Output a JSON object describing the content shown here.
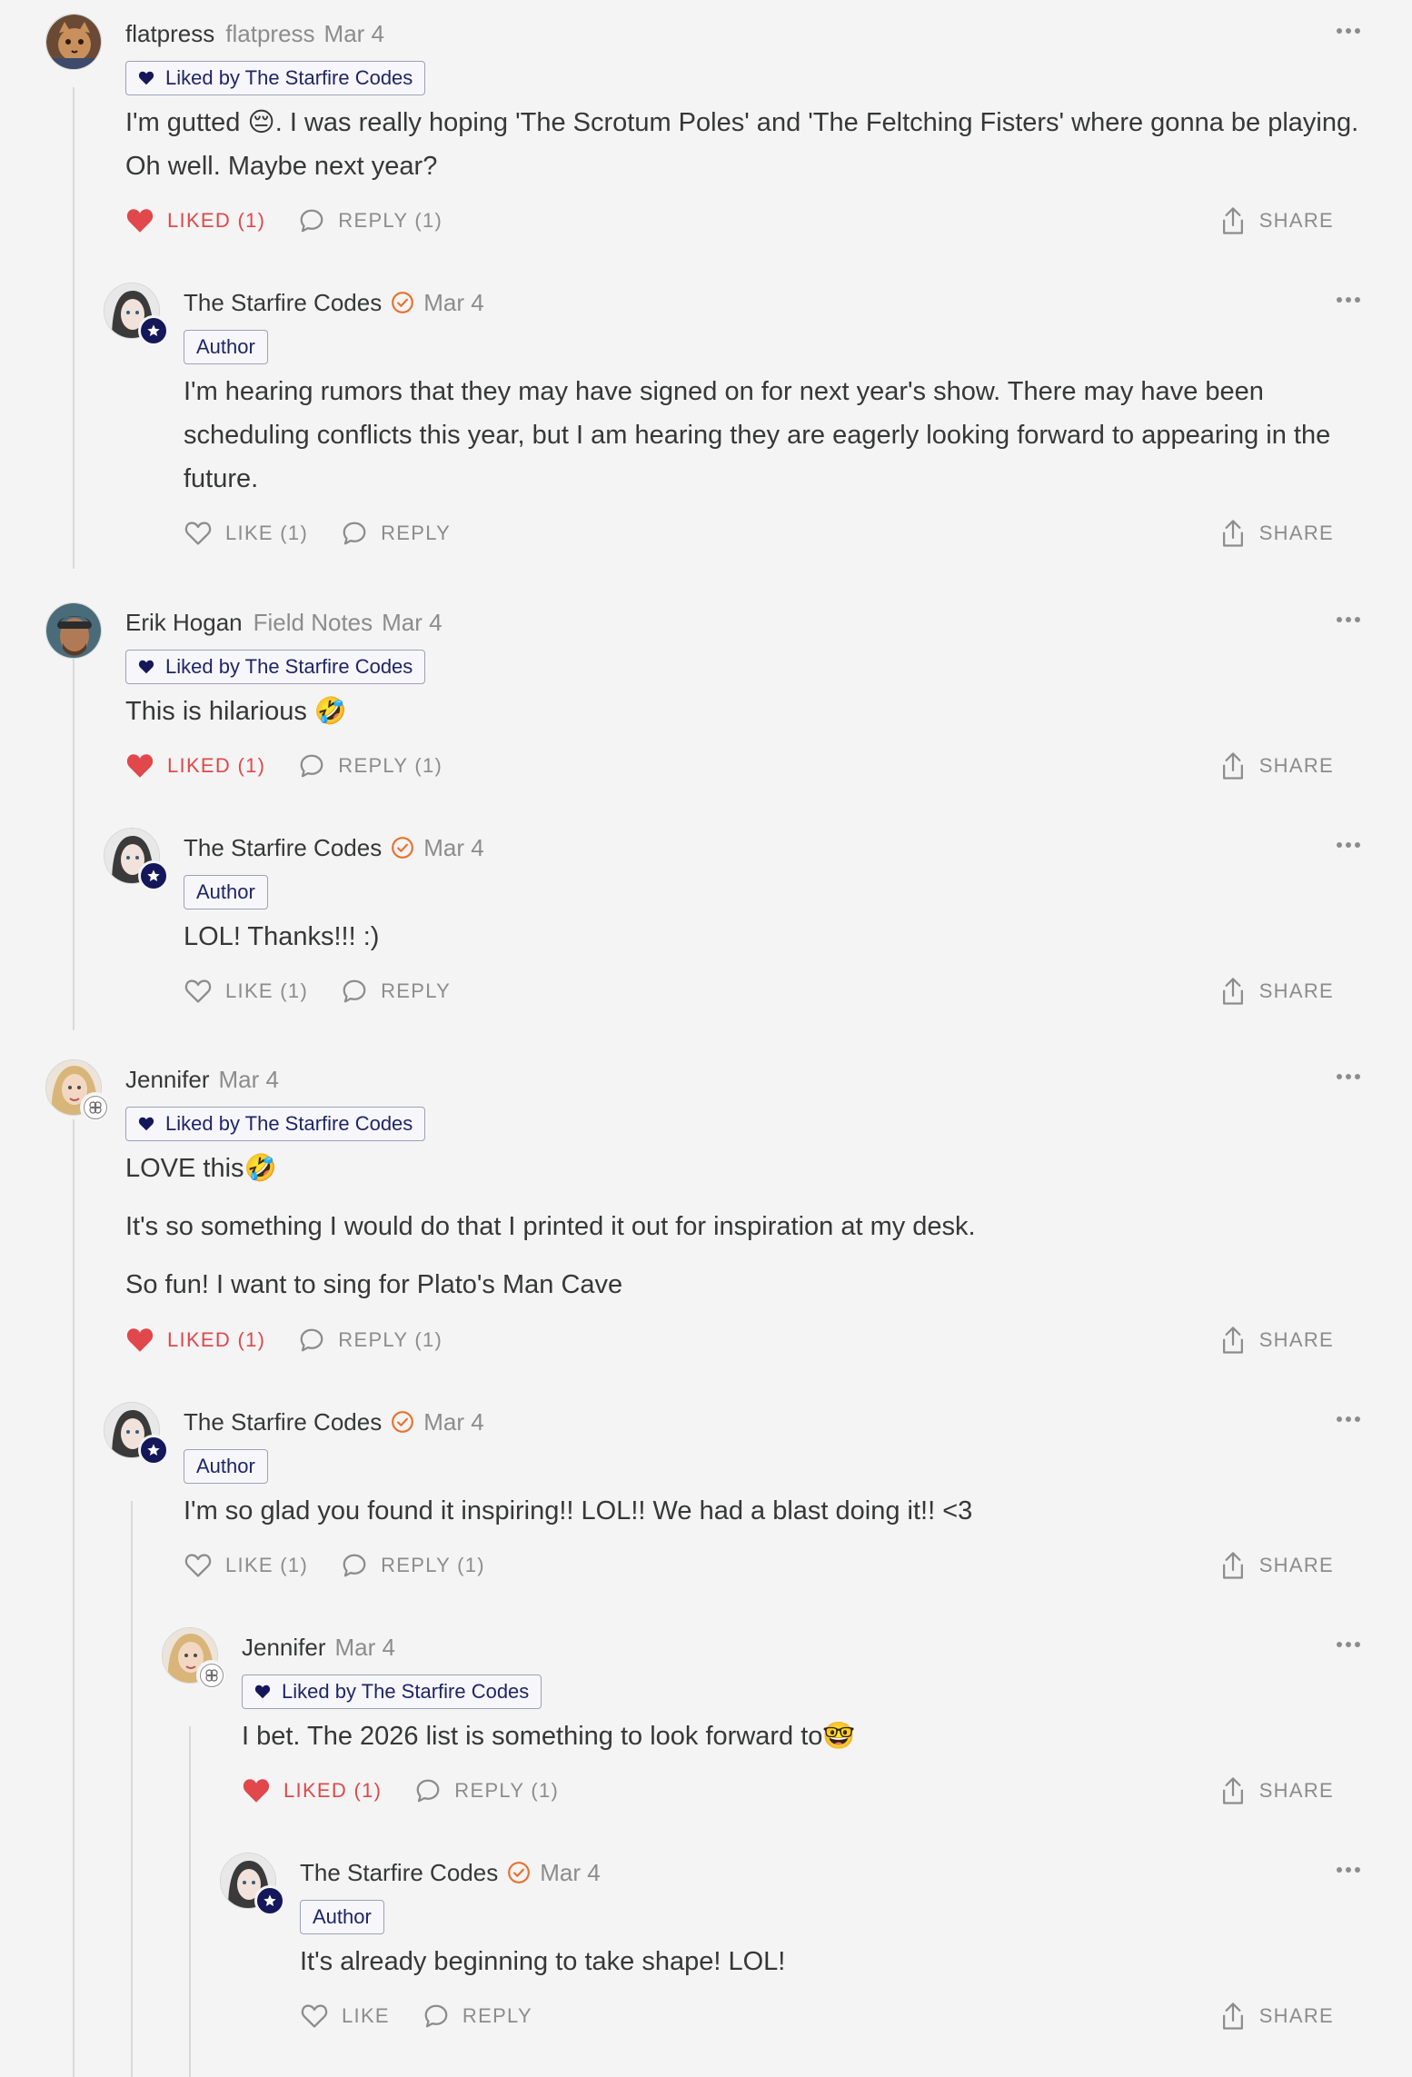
{
  "theme": {
    "liked_color": "#e0484b",
    "author_color": "#14175a",
    "check_color": "#e8712c",
    "badge_border": "#9ea0b8"
  },
  "comments": [
    {
      "name": "flatpress",
      "pub": "flatpress",
      "date": "Mar 4",
      "avatar": "cat",
      "tag": "Liked by The Starfire Codes",
      "body": [
        "I'm gutted 😔. I was really hoping 'The Scrotum Poles' and 'The Feltching Fisters' where gonna be playing. Oh well. Maybe next year?"
      ],
      "like_label": "LIKED (1)",
      "like_state": "liked",
      "reply_label": "REPLY (1)",
      "share_label": "SHARE"
    },
    {
      "name": "The Starfire Codes",
      "date": "Mar 4",
      "avatar": "woman",
      "tag": "Author",
      "body": [
        "I'm hearing rumors that they may have signed on for next year's show. There may have been scheduling conflicts this year, but I am hearing they are eagerly looking forward to appearing in the future."
      ],
      "like_label": "LIKE (1)",
      "like_state": "like",
      "reply_label": "REPLY",
      "share_label": "SHARE"
    },
    {
      "name": "Erik Hogan",
      "pub": "Field Notes",
      "date": "Mar 4",
      "avatar": "man",
      "tag": "Liked by The Starfire Codes",
      "body": [
        "This is hilarious 🤣"
      ],
      "like_label": "LIKED (1)",
      "like_state": "liked",
      "reply_label": "REPLY (1)",
      "share_label": "SHARE"
    },
    {
      "name": "The Starfire Codes",
      "date": "Mar 4",
      "avatar": "woman",
      "tag": "Author",
      "body": [
        "LOL! Thanks!!! :)"
      ],
      "like_label": "LIKE (1)",
      "like_state": "like",
      "reply_label": "REPLY",
      "share_label": "SHARE"
    },
    {
      "name": "Jennifer",
      "date": "Mar 4",
      "avatar": "blonde",
      "tag": "Liked by The Starfire Codes",
      "body": [
        "LOVE this🤣",
        "It's so something I would do that I printed it out for inspiration at my desk.",
        "So fun! I want to sing for Plato's Man Cave"
      ],
      "like_label": "LIKED (1)",
      "like_state": "liked",
      "reply_label": "REPLY (1)",
      "share_label": "SHARE"
    },
    {
      "name": "The Starfire Codes",
      "date": "Mar 4",
      "avatar": "woman",
      "tag": "Author",
      "body": [
        "I'm so glad you found it inspiring!! LOL!! We had a blast doing it!! <3"
      ],
      "like_label": "LIKE (1)",
      "like_state": "like",
      "reply_label": "REPLY (1)",
      "share_label": "SHARE"
    },
    {
      "name": "Jennifer",
      "date": "Mar 4",
      "avatar": "blonde",
      "tag": "Liked by The Starfire Codes",
      "body": [
        "I bet. The 2026 list is something to look forward to🤓"
      ],
      "like_label": "LIKED (1)",
      "like_state": "liked",
      "reply_label": "REPLY (1)",
      "share_label": "SHARE"
    },
    {
      "name": "The Starfire Codes",
      "date": "Mar 4",
      "avatar": "woman",
      "tag": "Author",
      "body": [
        "It's already beginning to take shape! LOL!"
      ],
      "like_label": "LIKE",
      "like_state": "like",
      "reply_label": "REPLY",
      "share_label": "SHARE"
    }
  ]
}
